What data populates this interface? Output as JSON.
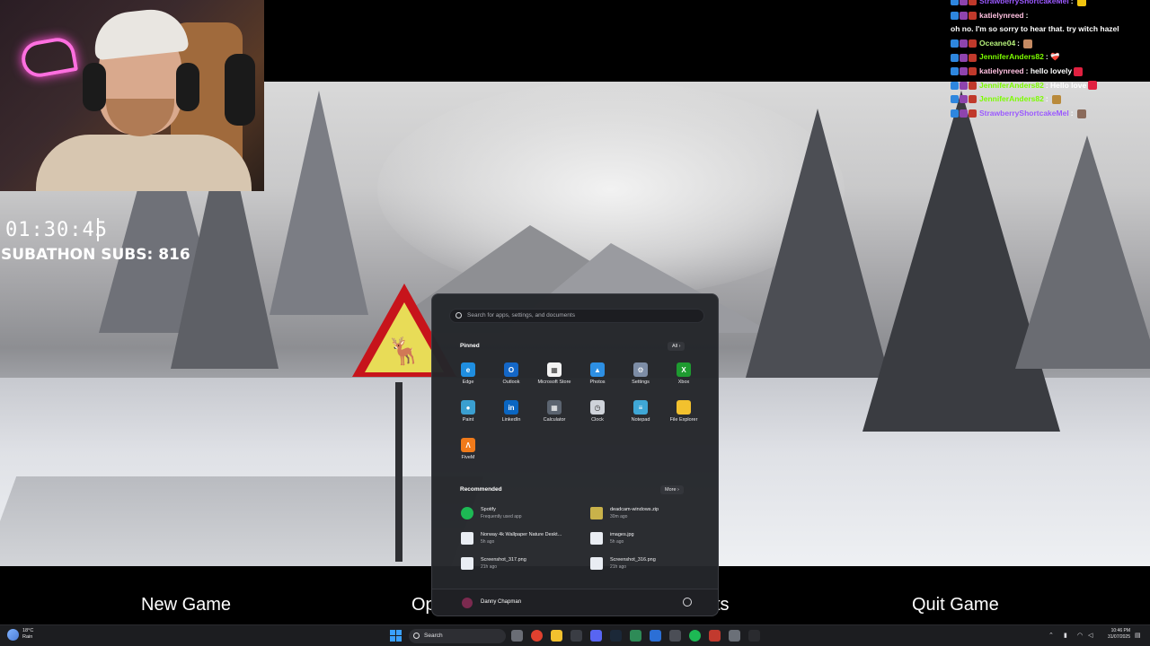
{
  "overlay": {
    "timer": "01:30:45",
    "subs_label": "SUBATHON SUBS: 816"
  },
  "chat": [
    {
      "user": "StrawberryShortcakeMel",
      "color": "#9b59ff",
      "message": "",
      "emoji_color": "#f1c40f"
    },
    {
      "user": "katielynreed",
      "color": "#ffc0e0",
      "message": "oh no. I'm so sorry to hear that. try witch hazel",
      "emoji_color": ""
    },
    {
      "user": "Oceane04",
      "color": "#b5f07a",
      "message": "",
      "emoji_color": "#c58a62"
    },
    {
      "user": "JenniferAnders82",
      "color": "#7cfc00",
      "message": "❤️‍🩹",
      "emoji_color": ""
    },
    {
      "user": "katielynreed",
      "color": "#ffc0e0",
      "message": "hello lovely",
      "emoji_color": "#e02040"
    },
    {
      "user": "JenniferAnders82",
      "color": "#7cfc00",
      "message": "Hello love",
      "emoji_color": "#e02040"
    },
    {
      "user": "JenniferAnders82",
      "color": "#7cfc00",
      "message": "",
      "emoji_color": "#b98a3b"
    },
    {
      "user": "StrawberryShortcakeMel",
      "color": "#9b59ff",
      "message": "",
      "emoji_color": "#8a6a5a"
    }
  ],
  "game_menu": {
    "new_game": "New Game",
    "options_fragment": "Op",
    "credits_fragment": "ts",
    "quit_game": "Quit Game"
  },
  "start_menu": {
    "search_placeholder": "Search for apps, settings, and documents",
    "pinned_title": "Pinned",
    "all_button": "All  ›",
    "pinned": [
      {
        "name": "Edge",
        "icon": "edge-icon",
        "color": "#1f8ee0",
        "glyph": "e"
      },
      {
        "name": "Outlook",
        "icon": "outlook-icon",
        "color": "#1467c7",
        "glyph": "O"
      },
      {
        "name": "Microsoft Store",
        "icon": "store-icon",
        "color": "#f4f4f4",
        "glyph": "▦"
      },
      {
        "name": "Photos",
        "icon": "photos-icon",
        "color": "#2d8fe3",
        "glyph": "▲"
      },
      {
        "name": "Settings",
        "icon": "settings-icon",
        "color": "#7d8da6",
        "glyph": "⚙"
      },
      {
        "name": "Xbox",
        "icon": "xbox-icon",
        "color": "#1e9a30",
        "glyph": "X"
      },
      {
        "name": "Paint",
        "icon": "paint-icon",
        "color": "#3a9fd0",
        "glyph": "●"
      },
      {
        "name": "LinkedIn",
        "icon": "linkedin-icon",
        "color": "#0a66c2",
        "glyph": "in"
      },
      {
        "name": "Calculator",
        "icon": "calculator-icon",
        "color": "#5b6470",
        "glyph": "▦"
      },
      {
        "name": "Clock",
        "icon": "clock-icon",
        "color": "#cfd3da",
        "glyph": "◷"
      },
      {
        "name": "Notepad",
        "icon": "notepad-icon",
        "color": "#3fa7d6",
        "glyph": "≡"
      },
      {
        "name": "File Explorer",
        "icon": "folder-icon",
        "color": "#f2c12e",
        "glyph": ""
      },
      {
        "name": "FiveM",
        "icon": "fivem-icon",
        "color": "#f07a1a",
        "glyph": "Λ"
      }
    ],
    "recommended_title": "Recommended",
    "more_button": "More  ›",
    "recommended": [
      {
        "name": "Spotify",
        "sub": "Frequently used app",
        "icon": "spotify-icon",
        "color": "#1db954"
      },
      {
        "name": "deadcam-windows.zip",
        "sub": "30m ago",
        "icon": "zip-icon",
        "color": "#c9b24a"
      },
      {
        "name": "Norway 4k Wallpaper Nature Deskt...",
        "sub": "5h ago",
        "icon": "file-icon",
        "color": "#e9edf3"
      },
      {
        "name": "images.jpg",
        "sub": "5h ago",
        "icon": "file-icon",
        "color": "#e9edf3"
      },
      {
        "name": "Screenshot_317.png",
        "sub": "21h ago",
        "icon": "file-icon",
        "color": "#e9edf3"
      },
      {
        "name": "Screenshot_316.png",
        "sub": "21h ago",
        "icon": "file-icon",
        "color": "#e9edf3"
      }
    ],
    "user_name": "Danny Chapman"
  },
  "taskbar": {
    "weather_temp": "18°C",
    "weather_desc": "Rain",
    "search_label": "Search",
    "time": "10:46 PM",
    "date": "31/07/2025",
    "icons": [
      {
        "name": "task-view-icon",
        "color": "#6a6d75"
      },
      {
        "name": "chrome-icon",
        "color": "#e0412f"
      },
      {
        "name": "file-explorer-icon",
        "color": "#f2c12e"
      },
      {
        "name": "obs-icon",
        "color": "#3a3d44"
      },
      {
        "name": "discord-icon",
        "color": "#5865f2"
      },
      {
        "name": "steam-icon",
        "color": "#1b2838"
      },
      {
        "name": "app-green-icon",
        "color": "#2e8b57"
      },
      {
        "name": "app-blue-icon",
        "color": "#2b6fd6"
      },
      {
        "name": "app-grey-icon",
        "color": "#4b4e56"
      },
      {
        "name": "spotify-icon",
        "color": "#1db954"
      },
      {
        "name": "app-red-icon",
        "color": "#c23a2e"
      },
      {
        "name": "app-settings-icon",
        "color": "#6b7078"
      },
      {
        "name": "unreal-icon",
        "color": "#2a2b2f"
      }
    ]
  }
}
